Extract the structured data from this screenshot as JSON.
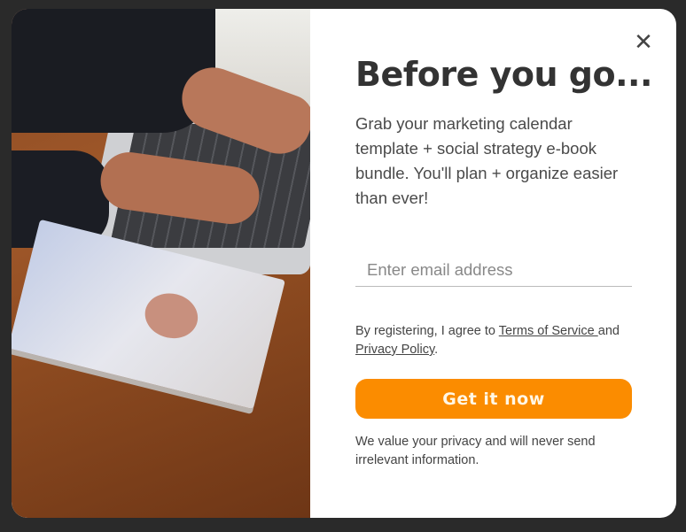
{
  "popup": {
    "close_icon": "close-icon",
    "title": "Before you go...",
    "description": "Grab your marketing calendar template + social strategy e-book bundle. You'll plan + organize easier than ever!",
    "email_placeholder": "Enter email address",
    "terms": {
      "prefix": "By registering, I agree to ",
      "terms_link": "Terms of Service ",
      "middle": "and",
      "privacy_link": "Privacy Policy",
      "suffix": "."
    },
    "cta_label": "Get it now",
    "privacy_note": "We value your privacy and will never send irrelevant information.",
    "accent_color": "#fb8c00"
  }
}
